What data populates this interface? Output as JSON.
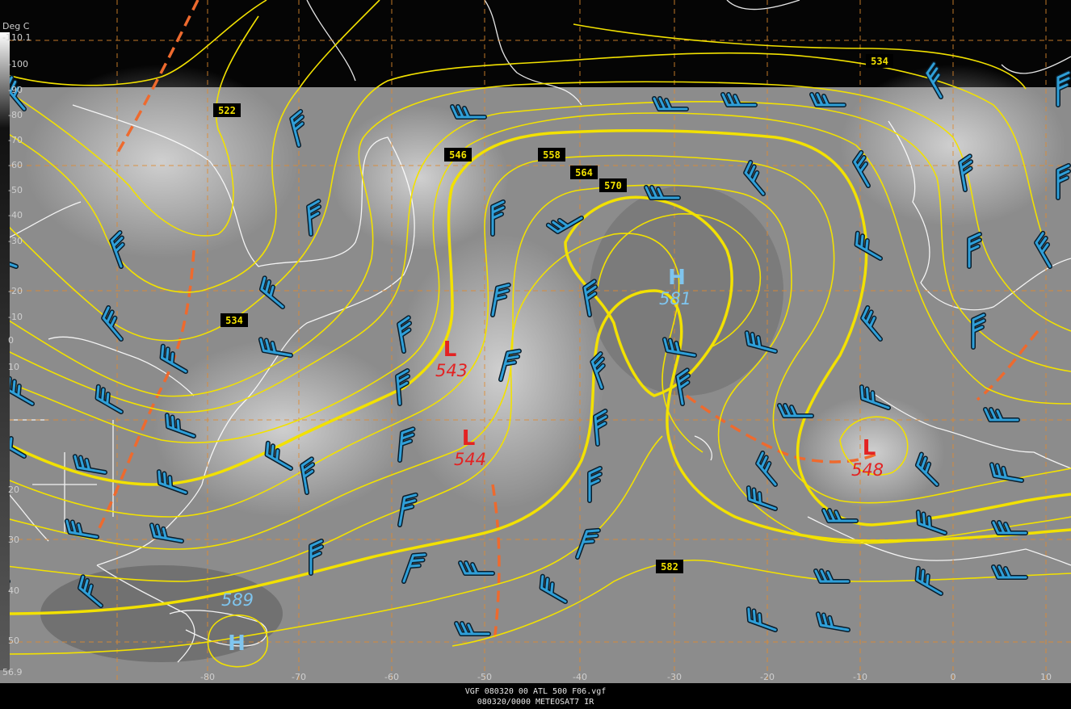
{
  "colors": {
    "background": "#000000",
    "satellite_gray": "#8c8c8c",
    "contour": "#f2e100",
    "trough": "#ee6a2e",
    "grid": "#e08a2e",
    "coast": "#ffffff",
    "wind_barb": "#2f9fd8",
    "low_label": "#e32222",
    "high_label": "#7fc5ee"
  },
  "scale": {
    "unit_label": "Deg C",
    "ticks": [
      "-110.1",
      "-100",
      "-90",
      "-80",
      "-70",
      "-60",
      "-50",
      "-40",
      "-30",
      "-20",
      "-10",
      "0",
      "10",
      "20",
      "30",
      "40",
      "50",
      "56.9"
    ]
  },
  "lon_ticks": [
    "-80",
    "-70",
    "-60",
    "-50",
    "-40",
    "-30",
    "-20",
    "-10",
    "0",
    "10"
  ],
  "height_labels": [
    "522",
    "534",
    "546",
    "558",
    "564",
    "570",
    "534",
    "582"
  ],
  "systems": [
    {
      "type": "L",
      "value": "543"
    },
    {
      "type": "L",
      "value": "544"
    },
    {
      "type": "H",
      "value": "581"
    },
    {
      "type": "L",
      "value": "548"
    },
    {
      "type": "H",
      "value": "589"
    }
  ],
  "wind_barb_icon": "wind-barb-icon",
  "footer": {
    "line1": "VGF 080320 00 ATL 500 F06.vgf",
    "line2": "080320/0000 METEOSAT7  IR"
  }
}
